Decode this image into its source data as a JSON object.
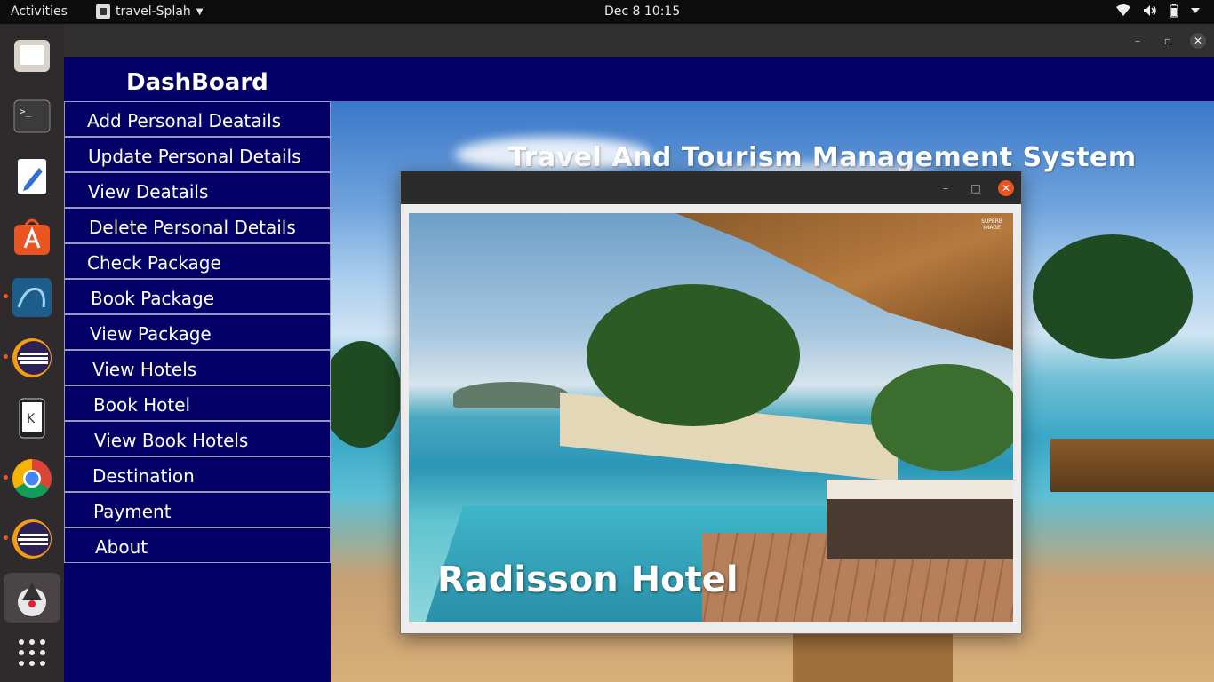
{
  "topbar": {
    "activities": "Activities",
    "app_name": "travel-Splah",
    "clock": "Dec 8  10:15"
  },
  "dock": {
    "items": [
      "files-icon",
      "terminal-icon",
      "text-editor-icon",
      "app-store-icon",
      "mysql-workbench-icon",
      "eclipse-icon",
      "kde-connect-icon",
      "chrome-icon",
      "eclipse-icon",
      "java-app-icon",
      "show-apps-icon"
    ]
  },
  "dashboard": {
    "title": "DashBoard",
    "menu": [
      "Add Personal Deatails",
      "Update Personal Details",
      "View Deatails",
      "Delete Personal Details",
      "Check Package",
      "Book Package",
      "View Package",
      "View Hotels",
      "Book Hotel",
      "View Book Hotels",
      "Destination",
      "Payment",
      "About"
    ]
  },
  "main": {
    "system_title": "Travel And Tourism Management System"
  },
  "hotel_window": {
    "hotel_name": "Radisson Hotel",
    "photo_logo": "SUPERB\nIMAGE"
  },
  "colors": {
    "sidebar_bg": "#020066",
    "accent_close": "#e95420"
  }
}
